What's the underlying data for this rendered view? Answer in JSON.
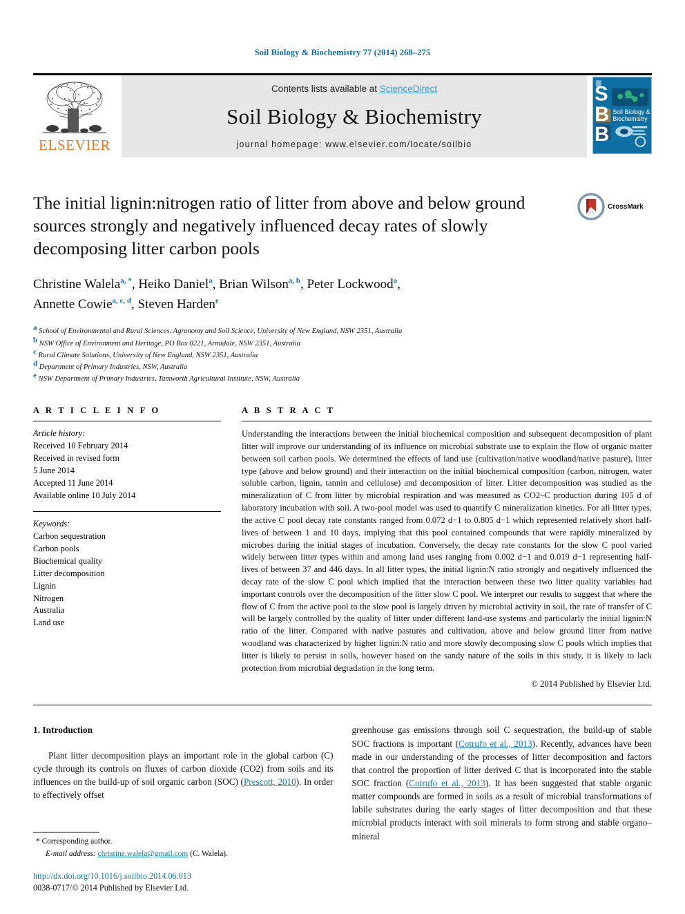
{
  "running_head": "Soil Biology & Biochemistry 77 (2014) 268–275",
  "masthead": {
    "elsevier_wordmark": "ELSEVIER",
    "contents_prefix": "Contents lists available at ",
    "sciencedirect": "ScienceDirect",
    "journal_title": "Soil Biology & Biochemistry",
    "homepage": "journal homepage: www.elsevier.com/locate/soilbio",
    "cover_letters": [
      "S",
      "B",
      "B"
    ],
    "cover_caption": "Soil Biology & Biochemistry",
    "sciencedirect_color": "#3d9cc9",
    "band_color": "#e6e6e6",
    "cover_color": "#0d6fa3",
    "elsevier_orange": "#E87722"
  },
  "article": {
    "title": "The initial lignin:nitrogen ratio of litter from above and below ground sources strongly and negatively influenced decay rates of slowly decomposing litter carbon pools",
    "crossmark_label": "CrossMark",
    "authors": [
      {
        "name": "Christine Walela",
        "marks": "a, *",
        "sep": ", "
      },
      {
        "name": "Heiko Daniel",
        "marks": "a",
        "sep": ", "
      },
      {
        "name": "Brian Wilson",
        "marks": "a, b",
        "sep": ", "
      },
      {
        "name": "Peter Lockwood",
        "marks": "a",
        "sep": ", "
      },
      {
        "name": "Annette Cowie",
        "marks": "a, c, d",
        "sep": ", "
      },
      {
        "name": "Steven Harden",
        "marks": "e",
        "sep": ""
      }
    ],
    "affiliations": [
      {
        "mark": "a",
        "text": "School of Environmental and Rural Sciences, Agronomy and Soil Science, University of New England, NSW 2351, Australia"
      },
      {
        "mark": "b",
        "text": "NSW Office of Environment and Heritage, PO Box 0221, Armidale, NSW 2351, Australia"
      },
      {
        "mark": "c",
        "text": "Rural Climate Solutions, University of New England, NSW 2351, Australia"
      },
      {
        "mark": "d",
        "text": "Department of Primary Industries, NSW, Australia"
      },
      {
        "mark": "e",
        "text": "NSW Department of Primary Industries, Tamworth Agricultural Institute, NSW, Australia"
      }
    ]
  },
  "article_info": {
    "heading": "A R T I C L E  I N F O",
    "history_label": "Article history:",
    "history": [
      "Received 10 February 2014",
      "Received in revised form",
      "5 June 2014",
      "Accepted 11 June 2014",
      "Available online 10 July 2014"
    ],
    "keywords_label": "Keywords:",
    "keywords": [
      "Carbon sequestration",
      "Carbon pools",
      "Biochemical quality",
      "Litter decomposition",
      "Lignin",
      "Nitrogen",
      "Australia",
      "Land use"
    ]
  },
  "abstract": {
    "heading": "A B S T R A C T",
    "text": "Understanding the interactions between the initial biochemical composition and subsequent decomposition of plant litter will improve our understanding of its influence on microbial substrate use to explain the flow of organic matter between soil carbon pools. We determined the effects of land use (cultivation/native woodland/native pasture), litter type (above and below ground) and their interaction on the initial biochemical composition (carbon, nitrogen, water soluble carbon, lignin, tannin and cellulose) and decomposition of litter. Litter decomposition was studied as the mineralization of C from litter by microbial respiration and was measured as CO2–C production during 105 d of laboratory incubation with soil. A two-pool model was used to quantify C mineralization kinetics. For all litter types, the active C pool decay rate constants ranged from 0.072 d−1 to 0.805 d−1 which represented relatively short half-lives of between 1 and 10 days, implying that this pool contained compounds that were rapidly mineralized by microbes during the initial stages of incubation. Conversely, the decay rate constants for the slow C pool varied widely between litter types within and among land uses ranging from 0.002 d−1 and 0.019 d−1 representing half-lives of between 37 and 446 days. In all litter types, the initial lignin:N ratio strongly and negatively influenced the decay rate of the slow C pool which implied that the interaction between these two litter quality variables had important controls over the decomposition of the litter slow C pool. We interpret our results to suggest that where the flow of C from the active pool to the slow pool is largely driven by microbial activity in soil, the rate of transfer of C will be largely controlled by the quality of litter under different land-use systems and particularly the initial lignin:N ratio of the litter. Compared with native pastures and cultivation, above and below ground litter from native woodland was characterized by higher lignin:N ratio and more slowly decomposing slow C pools which implies that litter is likely to persist in soils, however based on the sandy nature of the soils in this study, it is likely to lack protection from microbial degradation in the long term.",
    "copyright": "© 2014 Published by Elsevier Ltd."
  },
  "body": {
    "section_number_title": "1. Introduction",
    "left_paragraph_pre": "Plant litter decomposition plays an important role in the global carbon (C) cycle through its controls on fluxes of carbon dioxide (CO2) from soils and its influences on the build-up of soil organic carbon (SOC) (",
    "left_citation": "Prescott, 2010",
    "left_paragraph_post": "). In order to effectively offset",
    "right_pre": "greenhouse gas emissions through soil C sequestration, the build-up of stable SOC fractions is important (",
    "right_cite_1": "Cotrufo et al., 2013",
    "right_mid": "). Recently, advances have been made in our understanding of the processes of litter decomposition and factors that control the proportion of litter derived C that is incorporated into the stable SOC fraction (",
    "right_cite_2": "Cotrufo et al., 2013",
    "right_post": "). It has been suggested that stable organic matter compounds are formed in soils as a result of microbial transformations of labile substrates during the early stages of litter decomposition and that these microbial products interact with soil minerals to form strong and stable organo–mineral",
    "citation_color": "#0b7ab0"
  },
  "footnote": {
    "corresponding_marker": "*",
    "corresponding_text": "Corresponding author.",
    "email_label": "E-mail address:",
    "email": "christine.walela@gmail.com",
    "email_owner": "(C. Walela).",
    "doi": "http://dx.doi.org/10.1016/j.soilbio.2014.06.013",
    "issn_line_pre": "0038-0717/",
    "issn_line_post": "© 2014 Published by Elsevier Ltd."
  }
}
